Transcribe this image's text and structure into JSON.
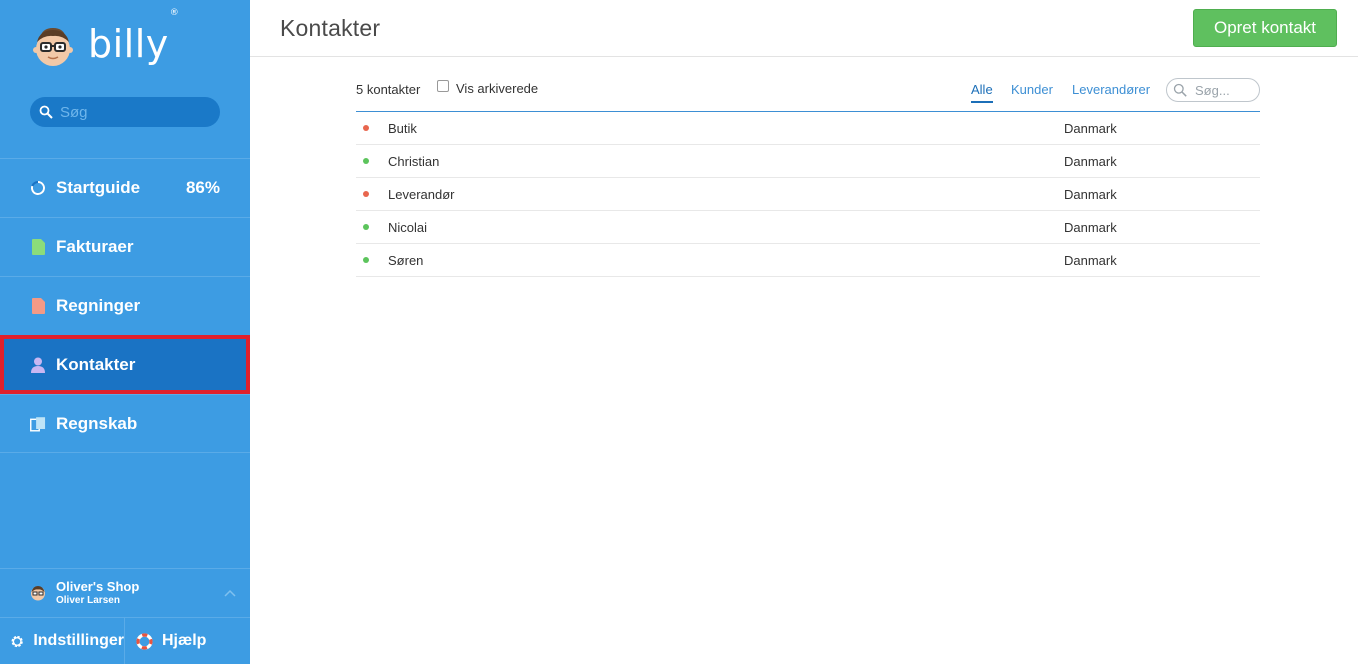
{
  "brand": {
    "name": "billy",
    "registered": "®"
  },
  "sidebar": {
    "search_placeholder": "Søg",
    "items": [
      {
        "label": "Startguide",
        "icon": "progress-ring-icon",
        "value": "86%",
        "progress": 0.86
      },
      {
        "label": "Fakturaer",
        "icon": "invoice-icon"
      },
      {
        "label": "Regninger",
        "icon": "bill-icon"
      },
      {
        "label": "Kontakter",
        "icon": "person-icon",
        "active": true
      },
      {
        "label": "Regnskab",
        "icon": "ledger-icon"
      }
    ],
    "account": {
      "shop": "Oliver's Shop",
      "user": "Oliver Larsen"
    },
    "settings_label": "Indstillinger",
    "help_label": "Hjælp"
  },
  "header": {
    "title": "Kontakter",
    "create_button": "Opret kontakt"
  },
  "toolbar": {
    "count": "5 kontakter",
    "show_archived": "Vis arkiverede",
    "filters": [
      "Alle",
      "Kunder",
      "Leverandører"
    ],
    "active_filter": "Alle",
    "search_placeholder": "Søg..."
  },
  "contacts": [
    {
      "name": "Butik",
      "country": "Danmark",
      "status_color": "#e8664e"
    },
    {
      "name": "Christian",
      "country": "Danmark",
      "status_color": "#5cc45c"
    },
    {
      "name": "Leverandør",
      "country": "Danmark",
      "status_color": "#e8664e"
    },
    {
      "name": "Nicolai",
      "country": "Danmark",
      "status_color": "#5cc45c"
    },
    {
      "name": "Søren",
      "country": "Danmark",
      "status_color": "#5cc45c"
    }
  ],
  "colors": {
    "sidebar": "#3d9ce3",
    "active_nav": "#1a73c4",
    "highlight_border": "#e0202c",
    "primary_button": "#5fc05f",
    "link": "#3d8fd4"
  }
}
